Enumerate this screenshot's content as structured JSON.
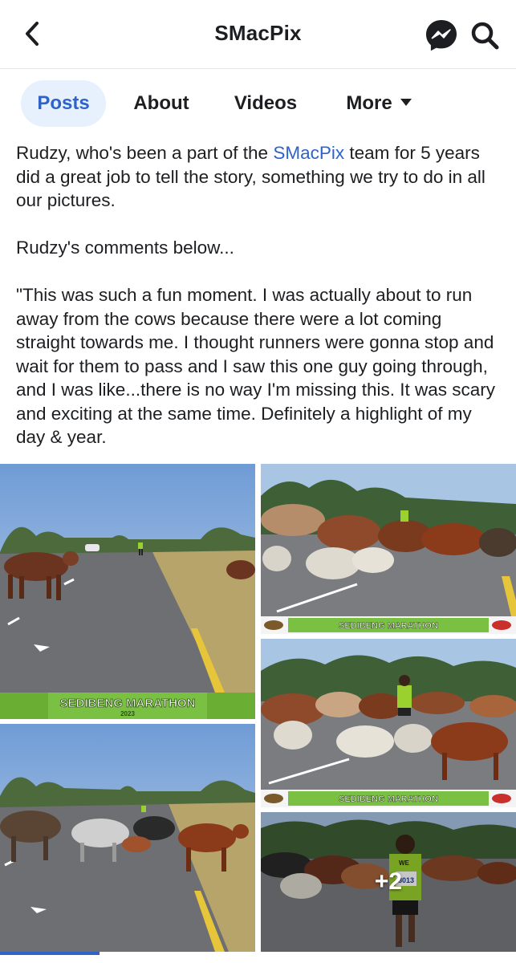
{
  "header": {
    "title": "SMacPix",
    "icons": {
      "back": "chevron-left-icon",
      "messenger": "messenger-icon",
      "search": "search-icon"
    }
  },
  "tabs": [
    {
      "label": "Posts",
      "active": true
    },
    {
      "label": "About",
      "active": false
    },
    {
      "label": "Videos",
      "active": false
    },
    {
      "label": "More",
      "active": false
    }
  ],
  "post": {
    "intro_before": "Rudzy, who's been a part of the ",
    "mention": "SMacPix",
    "intro_after": " team for 5 years did a great job to tell the story, something we try to do in all our pictures.",
    "comments_heading": "Rudzy's comments below...",
    "quote": "\"This was such a fun moment. I was actually about to run away from the cows because there were a lot coming straight towards me. I thought runners were gonna stop and wait for them to pass and I saw this one guy going through, and I was like...there is no way I'm missing this. It was scary and exciting at the same time. Definitely a highlight of my day & year."
  },
  "photos": {
    "banner_text": "SEDIBENG MARATHON",
    "banner_year": "2023",
    "bib_number": "8013",
    "bib_label": "WE",
    "more_count": "+2"
  },
  "colors": {
    "accent": "#2f63c7",
    "active_tab_bg": "#e7f0fd",
    "banner_green": "#7ac143"
  }
}
